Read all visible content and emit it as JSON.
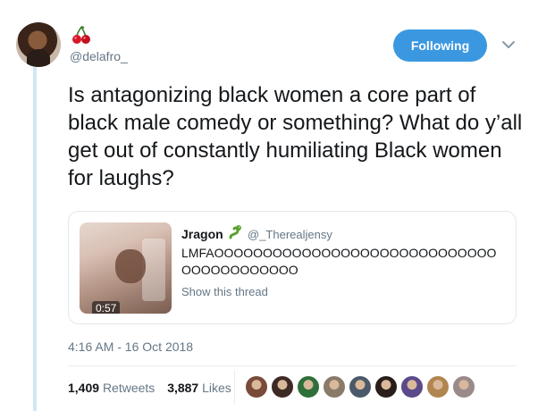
{
  "user": {
    "handle": "@delafro_",
    "avatar": "user-avatar",
    "name_icon": "cherry-emoji"
  },
  "header": {
    "follow_label": "Following",
    "menu_icon": "chevron-down-icon",
    "accent": "#3b98e0"
  },
  "tweet": {
    "text": "Is antagonizing black women a core part of black male comedy or something? What do y’all get out of constantly humiliating Black women for laughs?",
    "timestamp": "4:16 AM - 16 Oct 2018"
  },
  "quoted": {
    "name": "Jragon",
    "name_icon": "snake-emoji",
    "handle": "@_Therealjensy",
    "text": "LMFAOOOOOOOOOOOOOOOOOOOOOOOOOOOOOOOOOOOOOOOOO",
    "media_duration": "0:57",
    "show_thread": "Show this thread"
  },
  "stats": {
    "retweets_count": "1,409",
    "retweets_label": "Retweets",
    "likes_count": "3,887",
    "likes_label": "Likes"
  },
  "likers": [
    {
      "color": "#7a4a3a"
    },
    {
      "color": "#3d2a24"
    },
    {
      "color": "#2f6f3a"
    },
    {
      "color": "#8a7a6a"
    },
    {
      "color": "#4a5a6a"
    },
    {
      "color": "#2a1e1a"
    },
    {
      "color": "#5a4a8a"
    },
    {
      "color": "#b0854f"
    },
    {
      "color": "#9a8a8a"
    }
  ]
}
